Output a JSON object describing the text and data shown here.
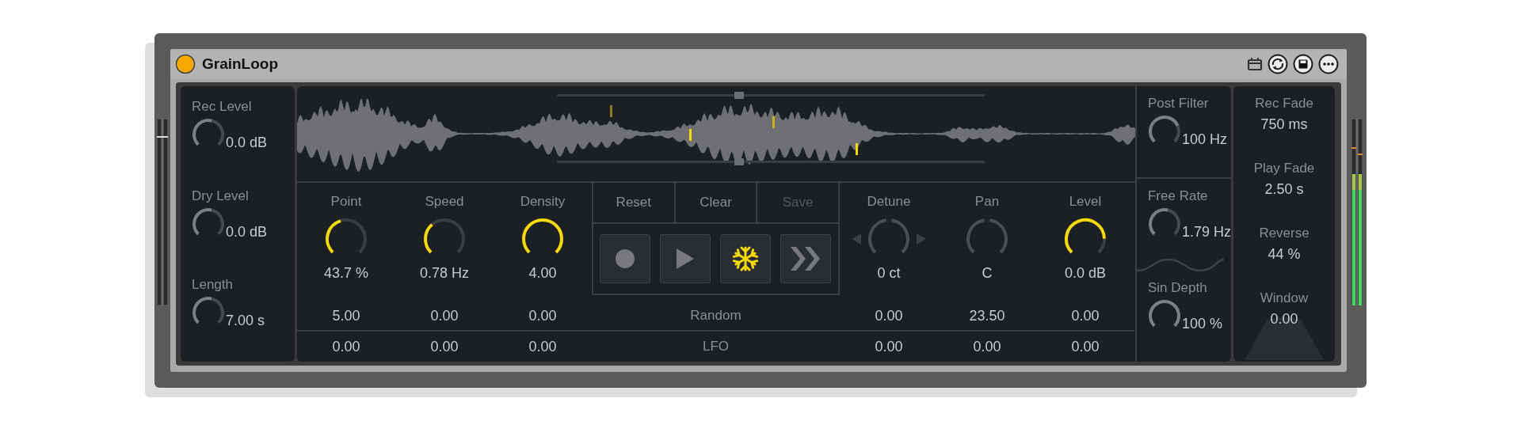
{
  "device": {
    "title": "GrainLoop",
    "on": true
  },
  "input_knobs": [
    {
      "label": "Rec Level",
      "value": "0.0 dB"
    },
    {
      "label": "Dry Level",
      "value": "0.0 dB"
    },
    {
      "label": "Length",
      "value": "7.00 s"
    }
  ],
  "grain_knobs": [
    {
      "label": "Point",
      "kind": "unipolar",
      "stepper": false,
      "value": "43.7 %",
      "random": "5.00",
      "lfo": "0.00"
    },
    {
      "label": "Speed",
      "kind": "unipolar",
      "stepper": false,
      "value": "0.78 Hz",
      "random": "0.00",
      "lfo": "0.00"
    },
    {
      "label": "Density",
      "kind": "unipolar",
      "stepper": false,
      "value": "4.00",
      "random": "0.00",
      "lfo": "0.00"
    }
  ],
  "actions": [
    {
      "label": "Reset",
      "disabled": false
    },
    {
      "label": "Clear",
      "disabled": false
    },
    {
      "label": "Save",
      "disabled": true
    }
  ],
  "transport": [
    {
      "kind": "record",
      "selected": false
    },
    {
      "kind": "play",
      "selected": false
    },
    {
      "kind": "freeze",
      "selected": true
    },
    {
      "kind": "skip",
      "selected": false
    }
  ],
  "row_labels": {
    "random": "Random",
    "lfo": "LFO"
  },
  "voice_knobs": [
    {
      "label": "Detune",
      "kind": "bipolar",
      "stepper": true,
      "value": "0 ct",
      "random": "0.00",
      "lfo": "0.00"
    },
    {
      "label": "Pan",
      "kind": "bipolar",
      "stepper": false,
      "value": "C",
      "random": "23.50",
      "lfo": "0.00"
    },
    {
      "label": "Level",
      "kind": "unipolar",
      "stepper": false,
      "value": "0.0 dB",
      "random": "0.00",
      "lfo": "0.00"
    }
  ],
  "mod_knobs": [
    {
      "label": "Post Filter",
      "value": "100 Hz"
    },
    {
      "label": "Free Rate",
      "value": "1.79 Hz"
    },
    {
      "label": "Sin Depth",
      "value": "100 %"
    }
  ],
  "fade_params": [
    {
      "label": "Rec Fade",
      "value": "750 ms"
    },
    {
      "label": "Play Fade",
      "value": "2.50 s"
    },
    {
      "label": "Reverse",
      "value": "44 %"
    },
    {
      "label": "Window",
      "value": "0.00"
    }
  ]
}
